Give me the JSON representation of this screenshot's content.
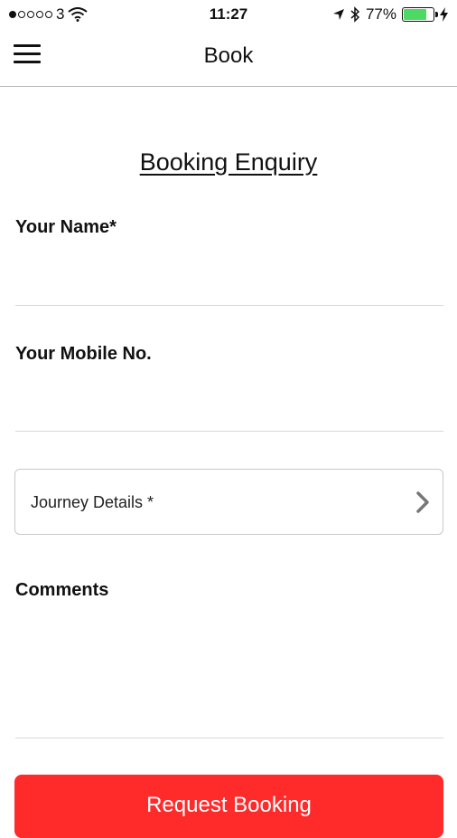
{
  "status_bar": {
    "carrier": "3",
    "time": "11:27",
    "battery_percent": "77%",
    "battery_level": 0.77,
    "icons": [
      "signal-dots-icon",
      "wifi-icon",
      "location-arrow-icon",
      "bluetooth-icon",
      "battery-icon",
      "charging-bolt-icon"
    ]
  },
  "nav": {
    "title": "Book",
    "menu_icon": "hamburger-menu-icon"
  },
  "form": {
    "heading": "Booking Enquiry",
    "name_label": "Your Name*",
    "name_value": "",
    "mobile_label": "Your Mobile No.",
    "mobile_value": "",
    "journey_label": "Journey Details *",
    "journey_icon": "chevron-right-icon",
    "comments_label": "Comments",
    "comments_value": "",
    "submit_label": "Request Booking"
  },
  "colors": {
    "accent": "#ff2a2a",
    "battery": "#4cd964",
    "divider": "#d9d9d9"
  }
}
